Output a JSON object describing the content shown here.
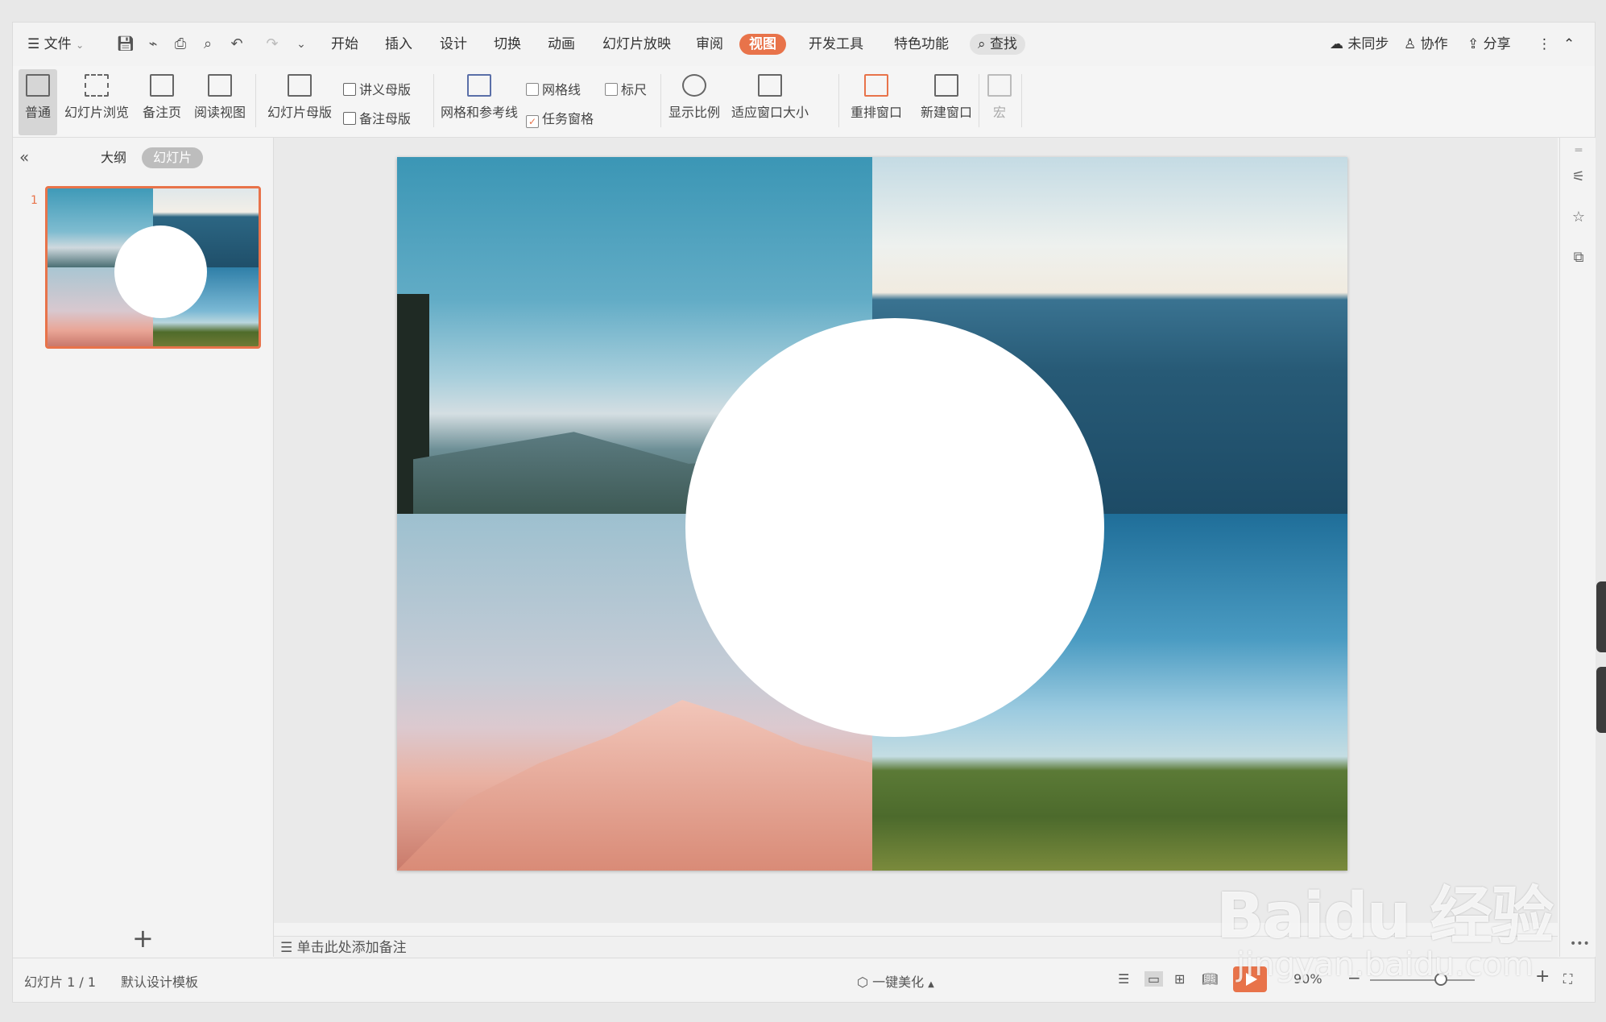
{
  "menu": {
    "file": "文件",
    "tabs": [
      "开始",
      "插入",
      "设计",
      "切换",
      "动画",
      "幻灯片放映",
      "审阅",
      "视图",
      "开发工具",
      "特色功能"
    ],
    "active_tab": "视图",
    "search": "查找",
    "sync": "未同步",
    "collab": "协作",
    "share": "分享"
  },
  "ribbon": {
    "normal": "普通",
    "slide_browse": "幻灯片浏览",
    "notes_page": "备注页",
    "reading_view": "阅读视图",
    "slide_master": "幻灯片母版",
    "handout_master": "讲义母版",
    "notes_master": "备注母版",
    "grid_guides": "网格和参考线",
    "gridlines": "网格线",
    "ruler": "标尺",
    "task_pane": "任务窗格",
    "zoom": "显示比例",
    "fit_window": "适应窗口大小",
    "arrange": "重排窗口",
    "new_window": "新建窗口",
    "macro": "宏"
  },
  "panel": {
    "tab_outline": "大纲",
    "tab_slides": "幻灯片",
    "slide_number": "1"
  },
  "notes_placeholder": "单击此处添加备注",
  "status": {
    "slide_info": "幻灯片 1 / 1",
    "template": "默认设计模板",
    "beautify": "一键美化",
    "zoom": "90%"
  },
  "watermark": {
    "main": "Bai",
    "mid": "du",
    "cn": "经验",
    "url": "jingyan.baidu.com"
  },
  "colors": {
    "accent": "#e8734a",
    "sky": "#3f9ab8",
    "sea": "#2a5f7a",
    "snow": "#e9a596",
    "grass": "#4f6b2a"
  }
}
